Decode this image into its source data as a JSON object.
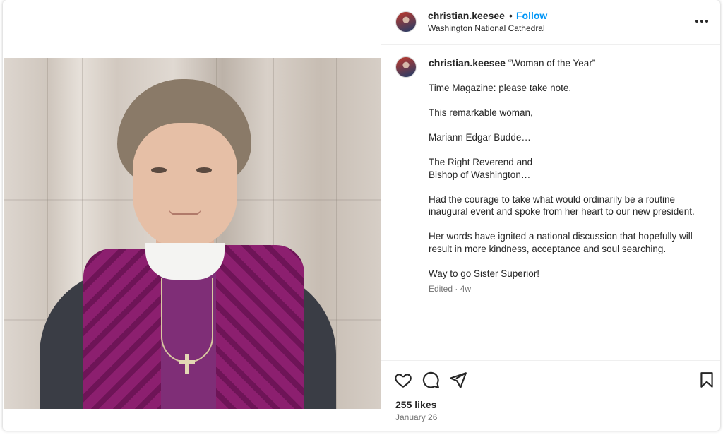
{
  "post": {
    "author": {
      "username": "christian.keesee",
      "avatar_icon": "profile-avatar"
    },
    "follow_label": "Follow",
    "separator": "•",
    "location": "Washington National Cathedral",
    "more_icon": "more-options-icon"
  },
  "caption": {
    "username": "christian.keesee",
    "first_line": "“Woman of the Year”",
    "paragraphs": [
      "Time Magazine: please take note.",
      "This remarkable woman,",
      "Mariann Edgar Budde…",
      "The Right Reverend and\nBishop of Washington…",
      "Had the courage to take what would ordinarily be a routine inaugural event and spoke from her heart to our new president.",
      "Her words have ignited a national discussion that hopefully will result in more kindness, acceptance and soul searching.",
      "Way to go Sister Superior!"
    ],
    "edited": "Edited · 4w"
  },
  "actions": {
    "icons": [
      "heart-icon",
      "comment-icon",
      "share-icon",
      "bookmark-icon"
    ]
  },
  "likes": "255 likes",
  "date": "January 26",
  "colors": {
    "accent": "#0095f6",
    "text": "#262626",
    "muted": "#737373",
    "divider": "#efefef"
  }
}
